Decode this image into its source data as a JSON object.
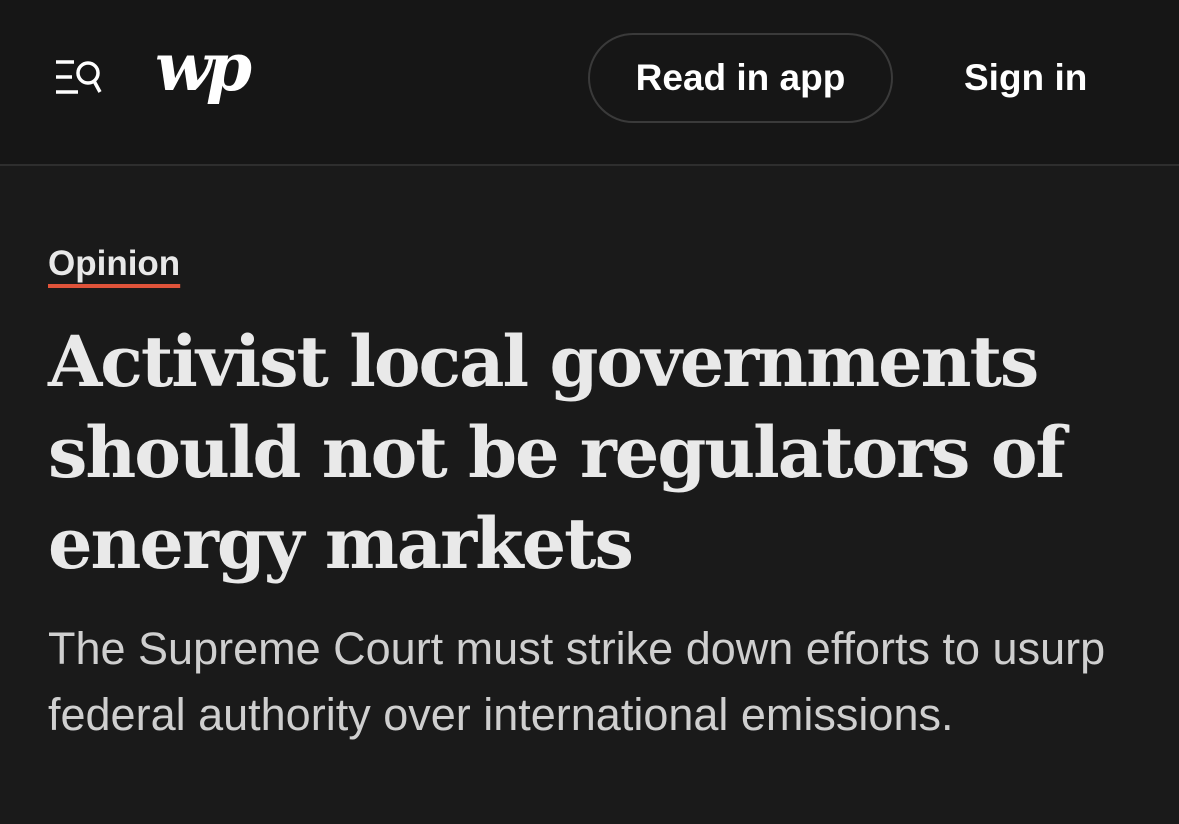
{
  "header": {
    "menu_icon": "menu-search-icon",
    "logo": "wp",
    "read_in_app_label": "Read in app",
    "sign_in_label": "Sign in"
  },
  "article": {
    "kicker": "Opinion",
    "headline": "Activist local governments should not be regulators of energy markets",
    "dek": "The Supreme Court must strike down efforts to usurp federal authority over international emissions."
  },
  "colors": {
    "background": "#1a1a1a",
    "header_background": "#161616",
    "kicker_underline": "#e0533a",
    "text": "#e9e9e9"
  }
}
